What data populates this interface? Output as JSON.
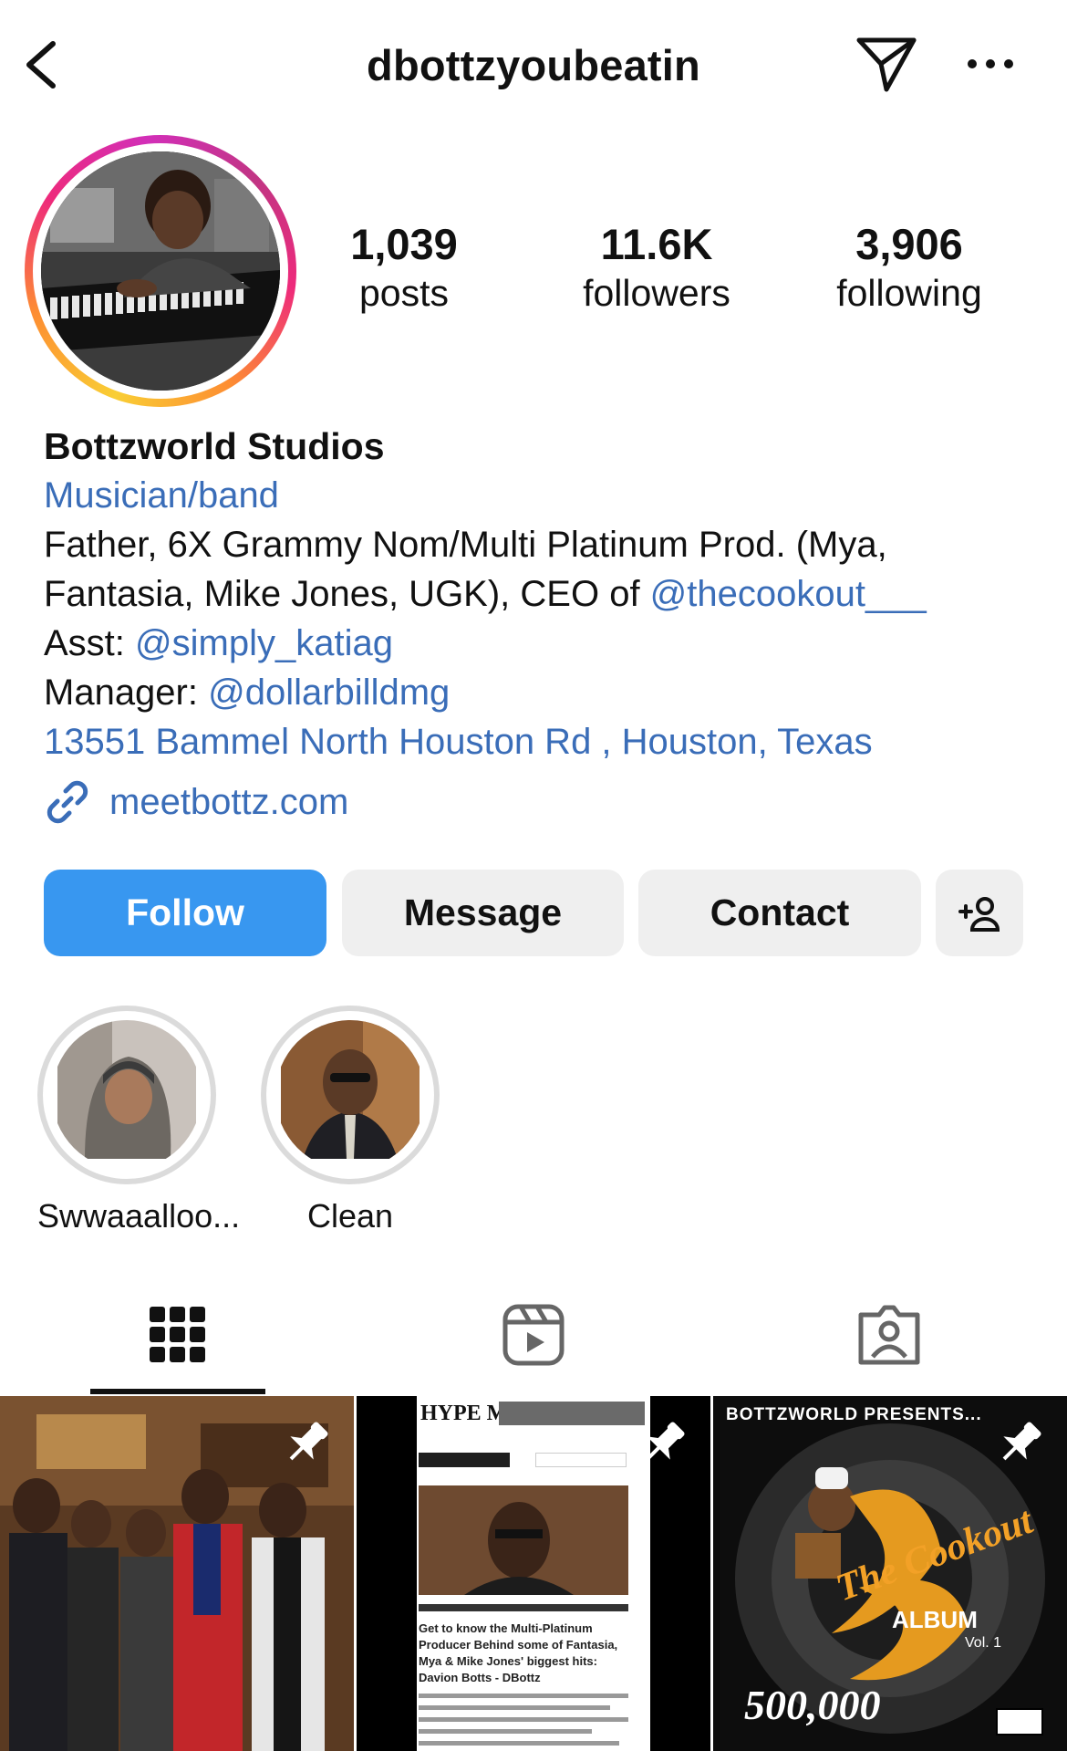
{
  "header": {
    "username": "dbottzyoubeatin"
  },
  "stats": {
    "posts": {
      "value": "1,039",
      "label": "posts"
    },
    "followers": {
      "value": "11.6K",
      "label": "followers"
    },
    "following": {
      "value": "3,906",
      "label": "following"
    }
  },
  "bio": {
    "name": "Bottzworld Studios",
    "category": "Musician/band",
    "line1": "Father, 6X Grammy Nom/Multi Platinum Prod. (Mya,",
    "line2_prefix": "Fantasia, Mike Jones, UGK), CEO of ",
    "line2_mention": "@thecookout___",
    "asst_prefix": "Asst: ",
    "asst_mention": "@simply_katiag",
    "manager_prefix": "Manager: ",
    "manager_mention": "@dollarbilldmg",
    "address": "13551 Bammel North Houston Rd , Houston, Texas",
    "website": "meetbottz.com"
  },
  "buttons": {
    "follow": "Follow",
    "message": "Message",
    "contact": "Contact"
  },
  "highlights": [
    {
      "label": "Swwaaalloo..."
    },
    {
      "label": "Clean"
    }
  ],
  "tabs": [
    "posts-grid",
    "reels",
    "tagged"
  ],
  "posts": [
    {
      "pinned": true,
      "caption": ""
    },
    {
      "pinned": true,
      "caption": "HYPE MAGAZINE",
      "headline": "Get to know the Multi-Platinum Producer Behind some of Fantasia, Mya & Mike Jones' biggest hits: Davion Botts - DBottz"
    },
    {
      "pinned": true,
      "caption": "BOTTZWORLD PRESENTS...",
      "title": "The Cookout",
      "subtitle": "ALBUM",
      "volume": "Vol. 1",
      "number": "500,000"
    }
  ],
  "colors": {
    "accent": "#3897f0",
    "link": "#3a6db8",
    "button_gray": "#efefef"
  }
}
